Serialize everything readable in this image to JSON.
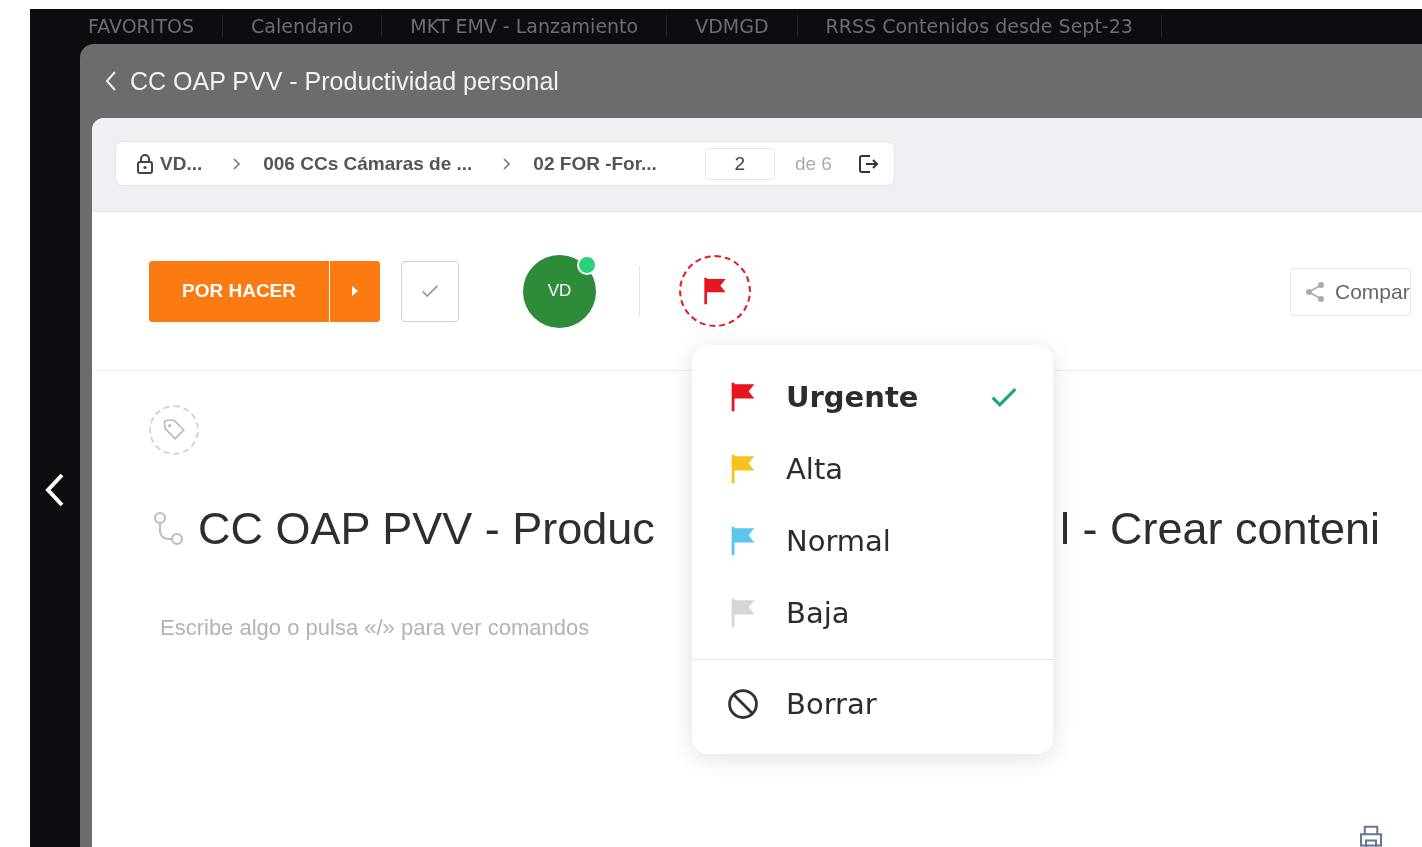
{
  "background_tabs": [
    "FAVORITOS",
    "Calendario",
    "MKT EMV - Lanzamiento",
    "VDMGD",
    "RRSS Contenidos desde Sept-23"
  ],
  "modal": {
    "title": "CC OAP PVV - Productividad personal"
  },
  "breadcrumb": {
    "items": [
      "VD...",
      "006 CCs Cámaras de ...",
      "02 FOR -For..."
    ],
    "page": "2",
    "page_total": "de 6"
  },
  "task": {
    "status": "POR HACER",
    "assignee_initials": "VD",
    "assignee_online": true,
    "share_label": "Compar",
    "title_parts": [
      "CC OAP PVV - Produc",
      "l - Crear conteni"
    ],
    "placeholder": "Escribe algo o pulsa «/» para ver comandos"
  },
  "priority_menu": {
    "items": [
      {
        "label": "Urgente",
        "color": "#e8141f",
        "selected": true
      },
      {
        "label": "Alta",
        "color": "#f7c31a",
        "selected": false
      },
      {
        "label": "Normal",
        "color": "#5cc6ee",
        "selected": false
      },
      {
        "label": "Baja",
        "color": "#d6d6d6",
        "selected": false
      }
    ],
    "clear_label": "Borrar"
  }
}
